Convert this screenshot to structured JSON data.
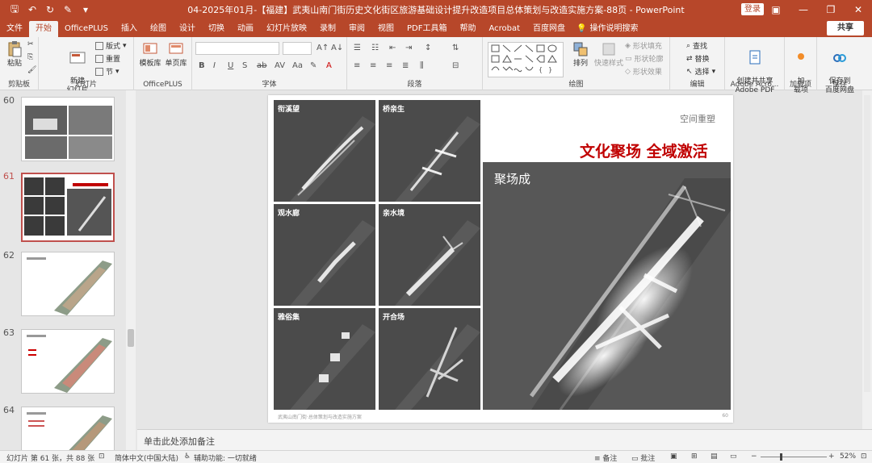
{
  "titlebar": {
    "title": "04-2025年01月-【福建】武夷山南门街历史文化街区旅游基础设计提升改造项目总体策划与改造实施方案-88页  -  PowerPoint",
    "login": "登录"
  },
  "tabs": [
    "文件",
    "开始",
    "OfficePLUS",
    "插入",
    "绘图",
    "设计",
    "切换",
    "动画",
    "幻灯片放映",
    "录制",
    "审阅",
    "视图",
    "PDF工具箱",
    "帮助",
    "Acrobat",
    "百度网盘"
  ],
  "search_label": "操作说明搜索",
  "share_label": "共享",
  "ribbon": {
    "clipboard": {
      "paste": "粘贴",
      "label": "剪贴板"
    },
    "slides": {
      "new_slide": "新建\n幻灯片",
      "layout": "版式",
      "reset": "重置",
      "section": "节",
      "label": "幻灯片"
    },
    "officeplus": {
      "template": "模板库",
      "single": "单页库",
      "label": "OfficePLUS"
    },
    "font": {
      "label": "字体"
    },
    "paragraph": {
      "label": "段落"
    },
    "drawing": {
      "arrange": "排列",
      "quick_styles": "快速样式",
      "fill": "形状填充",
      "outline": "形状轮廓",
      "effects": "形状效果",
      "label": "绘图"
    },
    "editing": {
      "find": "查找",
      "replace": "替换",
      "select": "选择",
      "label": "编辑"
    },
    "adobe": {
      "create": "创建并共享\nAdobe PDF",
      "label": "Adobe Acro..."
    },
    "addins": {
      "addins": "加\n载项",
      "label": "加载项"
    },
    "save": {
      "save_baidu": "保存到\n百度网盘",
      "label": "保存"
    }
  },
  "thumbnails": [
    {
      "num": "60"
    },
    {
      "num": "61"
    },
    {
      "num": "62"
    },
    {
      "num": "63"
    },
    {
      "num": "64"
    }
  ],
  "slide": {
    "panels": [
      "衔溪望",
      "桥亲生",
      "观水廊",
      "亲水境",
      "雅俗集",
      "开合场"
    ],
    "subtitle": "空间重塑",
    "headline": "文化聚场 全域激活",
    "big_panel_label": "聚场成",
    "footer": "武夷山南门街·总体策划与改造实施方案",
    "page_number": "60"
  },
  "notes_placeholder": "单击此处添加备注",
  "status": {
    "slide_info": "幻灯片 第 61 张，共 88 张",
    "language": "简体中文(中国大陆)",
    "accessibility": "辅助功能: 一切就绪",
    "notes": "备注",
    "comments": "批注",
    "zoom": "52%"
  },
  "colors": {
    "accent": "#b7472a",
    "headline": "#c00000"
  }
}
